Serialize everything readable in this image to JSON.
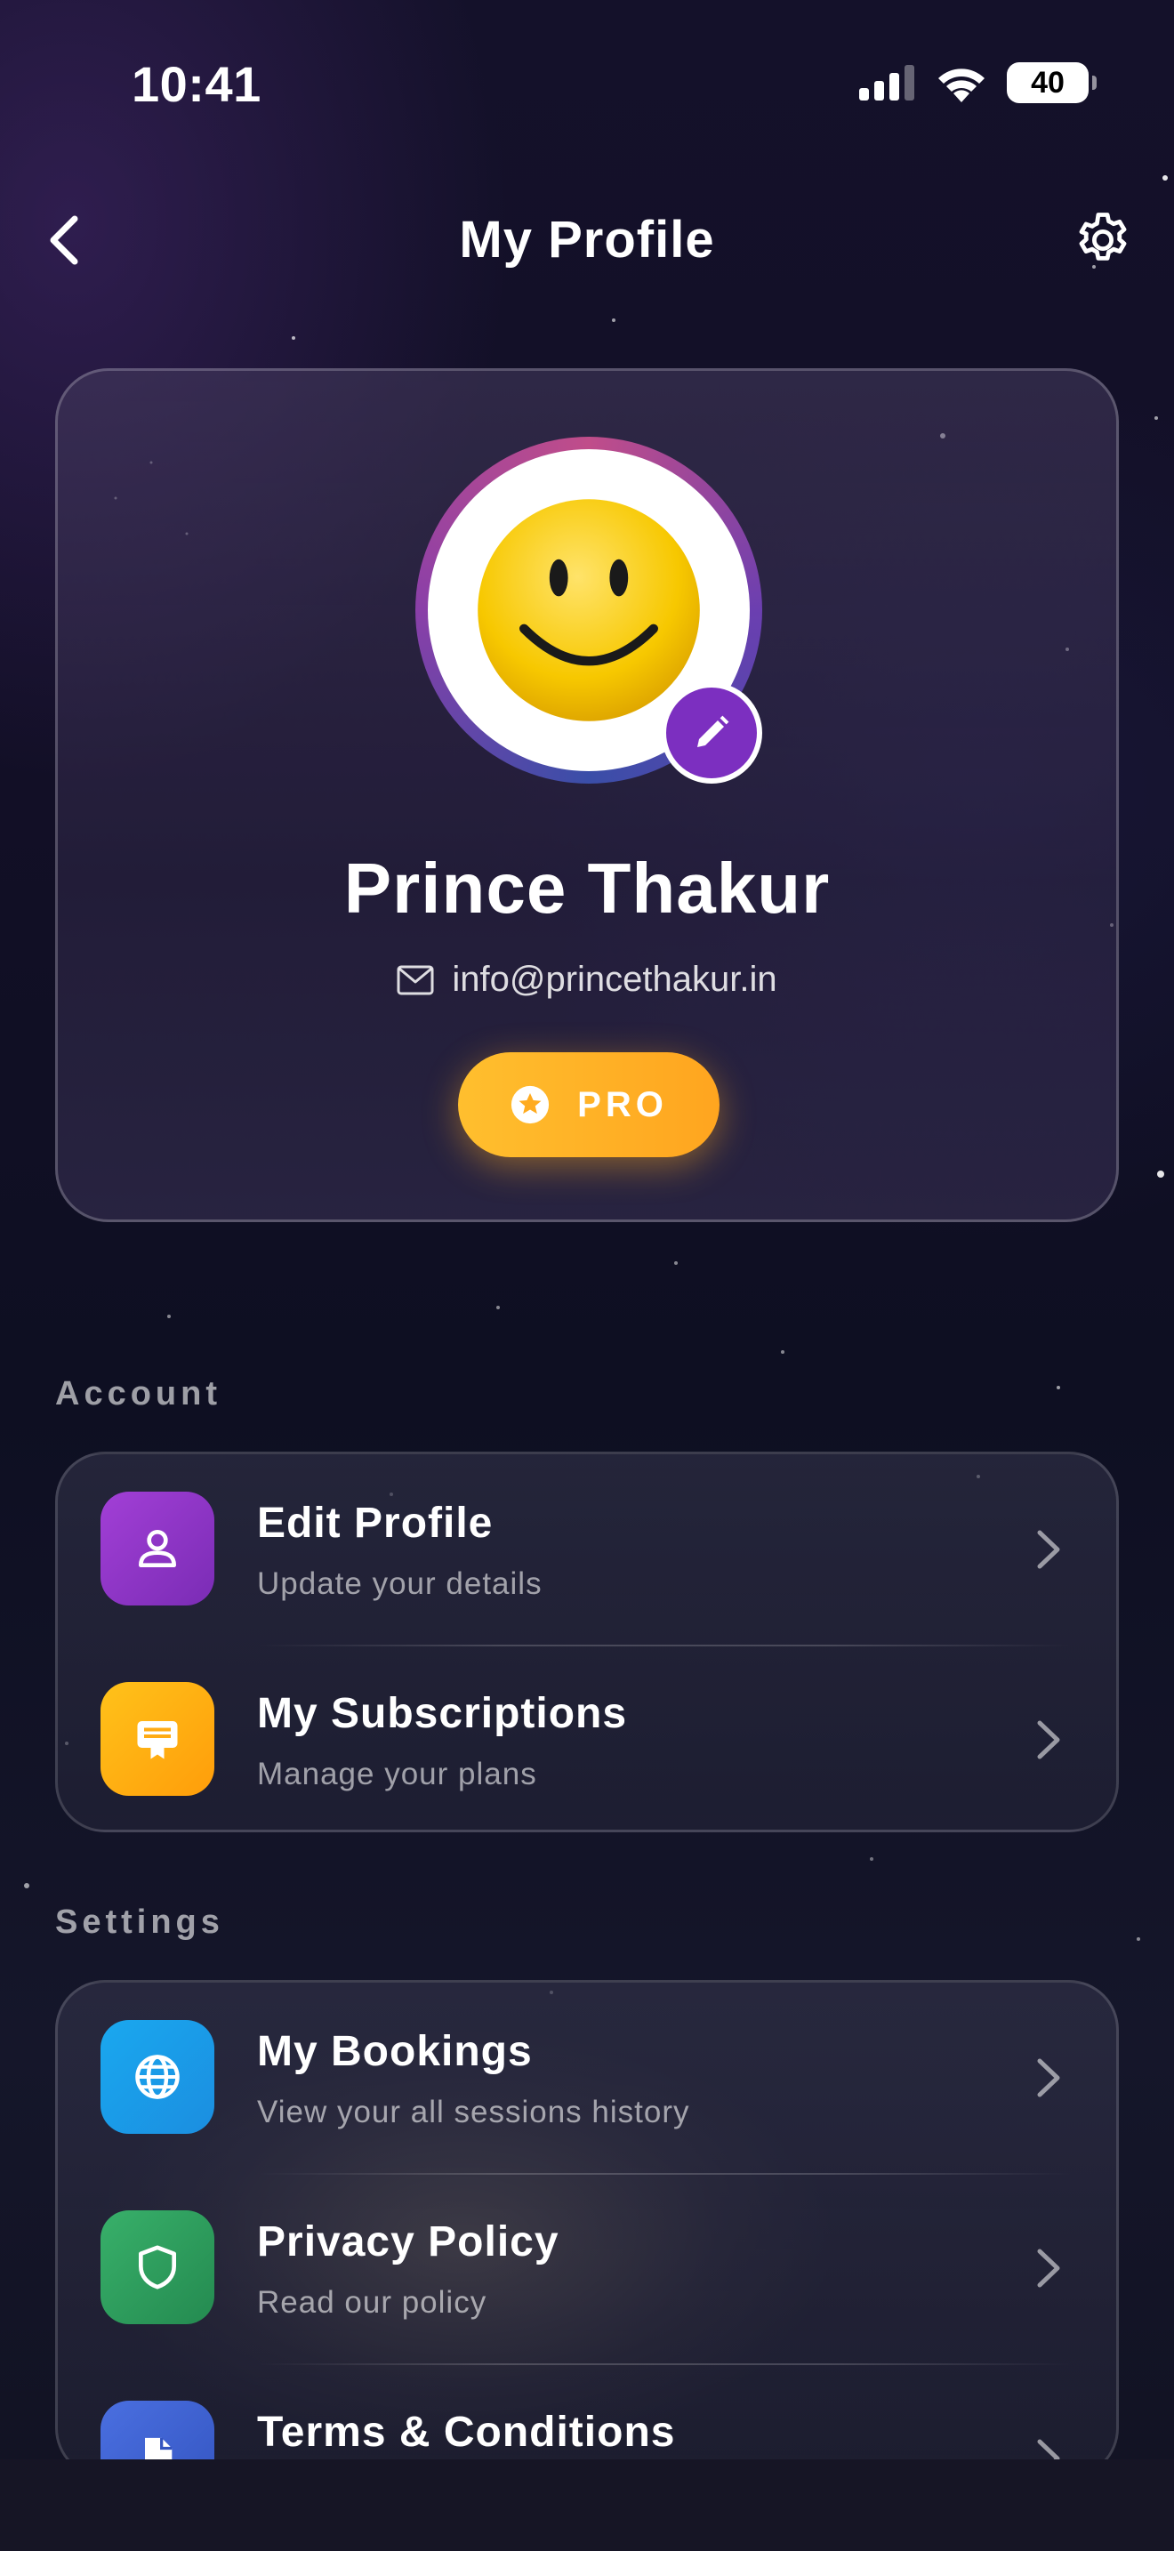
{
  "status_bar": {
    "time": "10:41",
    "battery": "40"
  },
  "header": {
    "title": "My Profile"
  },
  "profile": {
    "name": "Prince Thakur",
    "email": "info@princethakur.in",
    "badge": "PRO"
  },
  "sections": {
    "account": {
      "label": "Account",
      "items": [
        {
          "title": "Edit Profile",
          "subtitle": "Update your details",
          "icon": "user-icon",
          "color": "#8e35c9"
        },
        {
          "title": "My Subscriptions",
          "subtitle": "Manage your plans",
          "icon": "certificate-icon",
          "color": "#ffab14"
        }
      ]
    },
    "settings": {
      "label": "Settings",
      "items": [
        {
          "title": "My Bookings",
          "subtitle": "View your all sessions history",
          "icon": "globe-icon",
          "color": "#1e9ee6"
        },
        {
          "title": "Privacy Policy",
          "subtitle": "Read our policy",
          "icon": "shield-icon",
          "color": "#2f9a5c"
        },
        {
          "title": "Terms & Conditions",
          "subtitle": "",
          "icon": "document-icon",
          "color": "#3a5fc9"
        }
      ]
    }
  },
  "colors": {
    "accent_purple": "#7c2fc0",
    "pro_gold": "#ffb524"
  }
}
